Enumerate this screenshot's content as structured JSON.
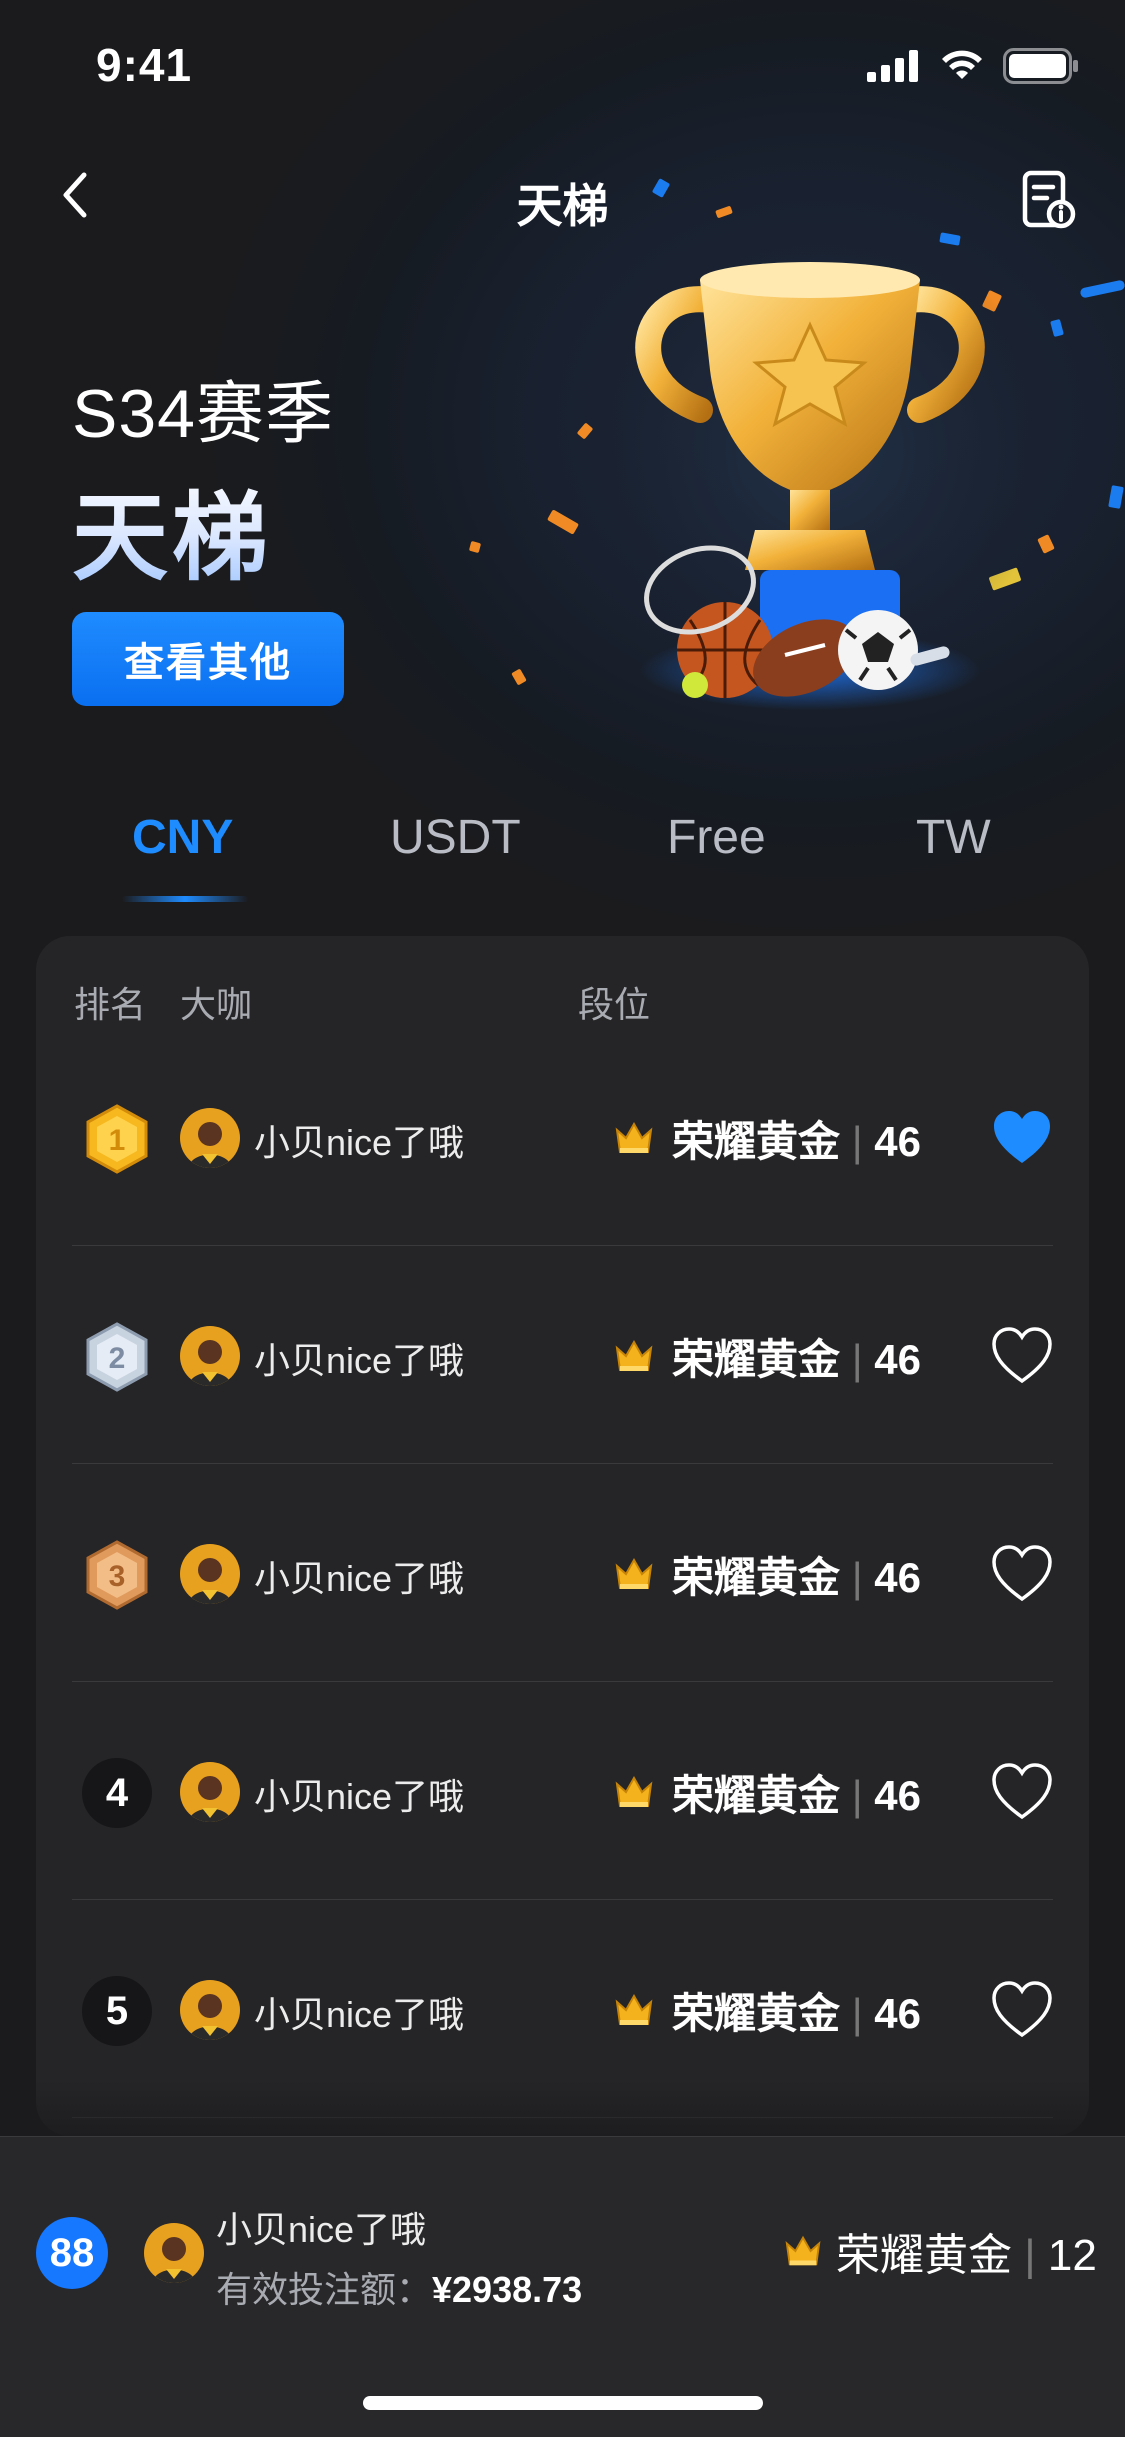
{
  "status_bar": {
    "time": "9:41"
  },
  "nav": {
    "title": "天梯"
  },
  "hero": {
    "season": "S34赛季",
    "title": "天梯",
    "button_label": "查看其他"
  },
  "tabs": [
    {
      "label": "CNY",
      "active": true
    },
    {
      "label": "USDT",
      "active": false
    },
    {
      "label": "Free",
      "active": false
    },
    {
      "label": "TW",
      "active": false
    }
  ],
  "table": {
    "headers": {
      "rank": "排名",
      "player": "大咖",
      "tier": "段位"
    },
    "rows": [
      {
        "rank": "1",
        "name": "小贝nice了哦",
        "tier": "荣耀黄金",
        "score": "46",
        "liked": true
      },
      {
        "rank": "2",
        "name": "小贝nice了哦",
        "tier": "荣耀黄金",
        "score": "46",
        "liked": false
      },
      {
        "rank": "3",
        "name": "小贝nice了哦",
        "tier": "荣耀黄金",
        "score": "46",
        "liked": false
      },
      {
        "rank": "4",
        "name": "小贝nice了哦",
        "tier": "荣耀黄金",
        "score": "46",
        "liked": false
      },
      {
        "rank": "5",
        "name": "小贝nice了哦",
        "tier": "荣耀黄金",
        "score": "46",
        "liked": false
      }
    ]
  },
  "me": {
    "rank": "88",
    "name": "小贝nice了哦",
    "bet_label": "有效投注额：",
    "bet_value": "¥2938.73",
    "tier": "荣耀黄金",
    "score": "12"
  },
  "colors": {
    "accent": "#1e8cff",
    "panel": "#252527",
    "background": "#1b1b1d",
    "gold": "#f4b21c"
  },
  "icons": [
    "back-chevron-icon",
    "rules-document-icon",
    "trophy-illustration",
    "crown-icon",
    "heart-icon",
    "medal-icon"
  ]
}
